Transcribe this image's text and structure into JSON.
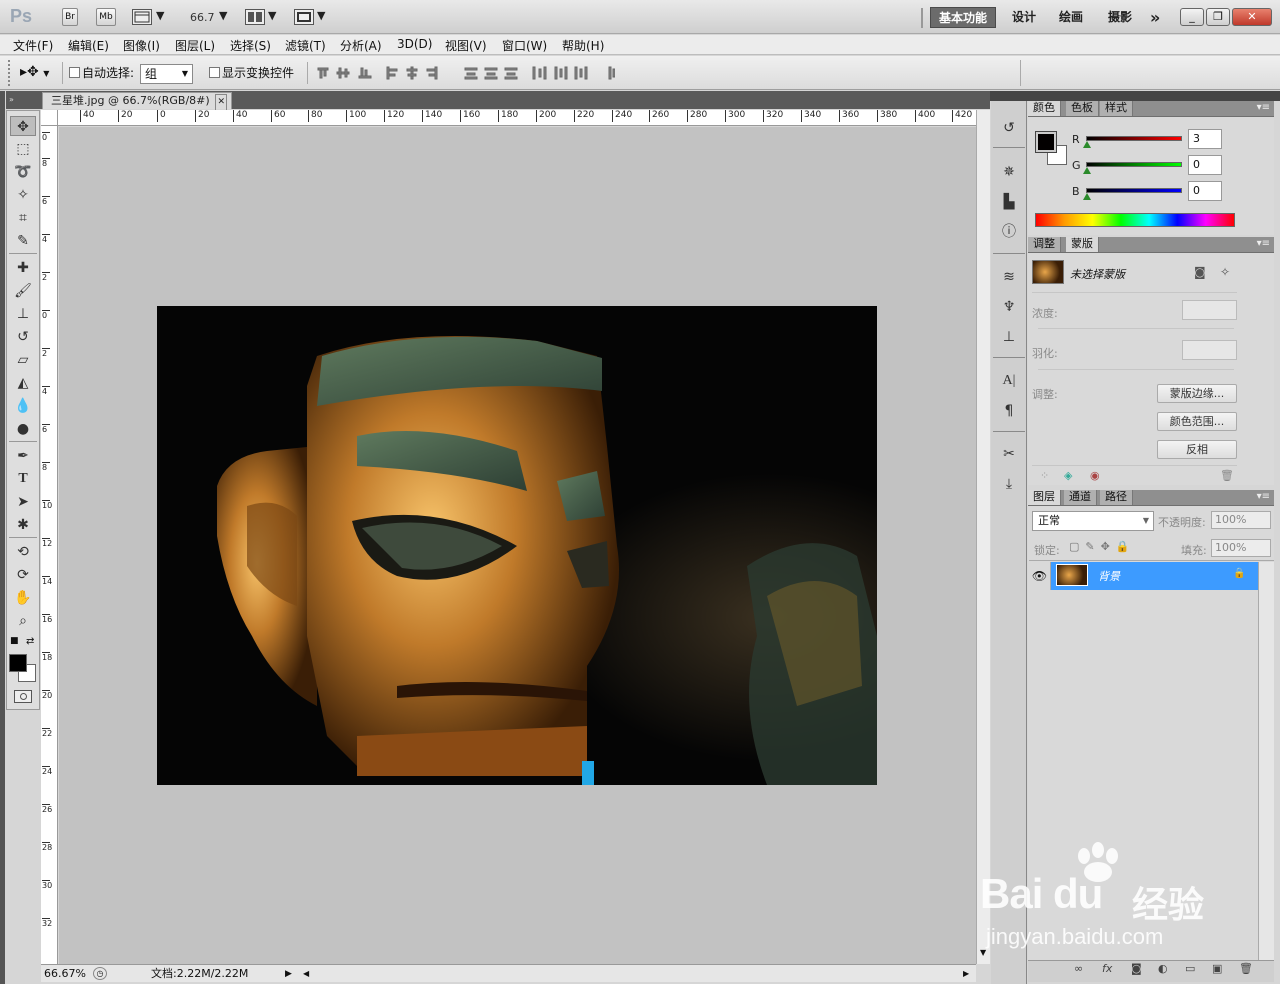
{
  "app": {
    "logo": "Ps",
    "bridge_label": "Br",
    "minibridge_label": "Mb",
    "zoom": "66.7",
    "dropdown_arrow": "▼"
  },
  "workspaces": [
    "基本功能",
    "设计",
    "绘画",
    "摄影"
  ],
  "workspace_more": "»",
  "menu": [
    "文件(F)",
    "编辑(E)",
    "图像(I)",
    "图层(L)",
    "选择(S)",
    "滤镜(T)",
    "分析(A)",
    "3D(D)",
    "视图(V)",
    "窗口(W)",
    "帮助(H)"
  ],
  "options": {
    "auto_select_label": "自动选择:",
    "auto_select_value": "组",
    "show_transform_label": "显示变换控件"
  },
  "document": {
    "tab_title": "三星堆.jpg @ 66.7%(RGB/8#)",
    "close_glyph": "✕",
    "zoom_status": "66.67%",
    "doc_size": "文档:2.22M/2.22M"
  },
  "ruler": {
    "h_ticks": [
      "40",
      "20",
      "0",
      "20",
      "40",
      "60",
      "80",
      "100",
      "120",
      "140",
      "160",
      "180",
      "200",
      "220",
      "240",
      "260",
      "280",
      "300",
      "320",
      "340",
      "360",
      "380",
      "400",
      "420"
    ],
    "v_ticks": [
      "0",
      "8",
      "6",
      "4",
      "2",
      "0",
      "2",
      "4",
      "6",
      "8",
      "10",
      "12",
      "14",
      "16",
      "18",
      "20",
      "22",
      "24",
      "26",
      "28",
      "30",
      "32"
    ]
  },
  "color_panel": {
    "tabs": [
      "颜色",
      "色板",
      "样式"
    ],
    "channels": [
      {
        "label": "R",
        "value": "3",
        "gradient": "linear-gradient(to right,#000000,#ff0000)"
      },
      {
        "label": "G",
        "value": "0",
        "gradient": "linear-gradient(to right,#000000,#00ff00)"
      },
      {
        "label": "B",
        "value": "0",
        "gradient": "linear-gradient(to right,#000000,#0000ff)"
      }
    ]
  },
  "mask_panel": {
    "tabs": [
      "调整",
      "蒙版"
    ],
    "title": "未选择蒙版",
    "density_label": "浓度:",
    "feather_label": "羽化:",
    "refine_label": "调整:",
    "buttons": [
      "蒙版边缘...",
      "颜色范围...",
      "反相"
    ]
  },
  "layers_panel": {
    "tabs": [
      "图层",
      "通道",
      "路径"
    ],
    "blend_mode": "正常",
    "opacity_label": "不透明度:",
    "opacity_value": "100%",
    "lock_label": "锁定:",
    "fill_label": "填充:",
    "fill_value": "100%",
    "layer_name": "背景",
    "bottom_icons": [
      "∞",
      "fx",
      "◙",
      "◐",
      "▭",
      "▣",
      "🗑"
    ]
  },
  "watermark": {
    "brand": "Bai du",
    "cn": "经验",
    "url": "jingyan.baidu.com"
  },
  "colors": {
    "accent_layer": "#3d9bff",
    "workspace_active": "#6b6b6b",
    "close_button": "#c0392b"
  }
}
